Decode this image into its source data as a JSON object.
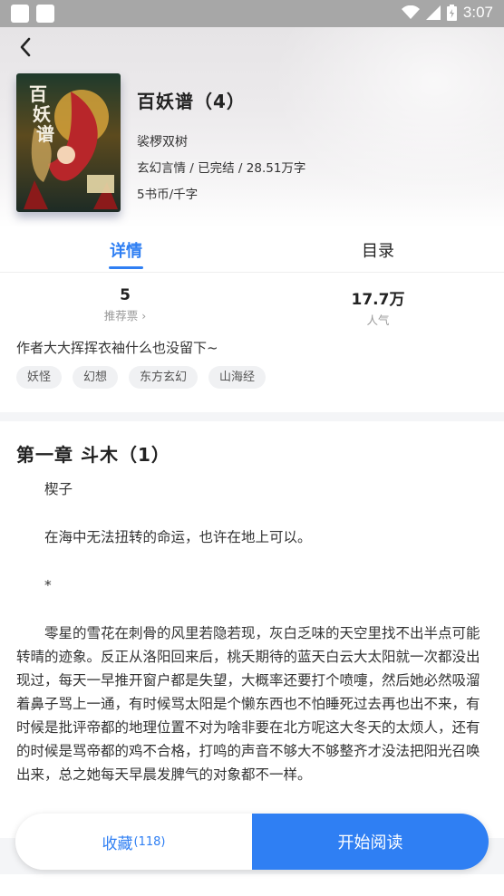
{
  "status_bar": {
    "time": "3:07"
  },
  "book": {
    "title": "百妖谱（4）",
    "author": "裟椤双树",
    "meta": "玄幻言情 / 已完结 / 28.51万字",
    "price": "5书币/千字",
    "cover_text": "百妖谱"
  },
  "tabs": [
    {
      "label": "详情"
    },
    {
      "label": "目录"
    }
  ],
  "stats": {
    "votes": {
      "value": "5",
      "label": "推荐票 ›"
    },
    "popularity": {
      "value": "17.7万",
      "label": "人气"
    }
  },
  "intro": "作者大大挥挥衣袖什么也没留下~",
  "tags": [
    "妖怪",
    "幻想",
    "东方玄幻",
    "山海经"
  ],
  "chapter": {
    "title": "第一章 斗木（1）",
    "paragraphs": [
      "楔子",
      "在海中无法扭转的命运，也许在地上可以。",
      "*",
      "零星的雪花在刺骨的风里若隐若现，灰白乏味的天空里找不出半点可能转晴的迹象。反正从洛阳回来后，桃夭期待的蓝天白云大太阳就一次都没出现过，每天一早推开窗户都是失望，大概率还要打个喷嚏，然后她必然吸溜着鼻子骂上一通，有时候骂太阳是个懒东西也不怕睡死过去再也出不来，有时候是批评帝都的地理位置不对为啥非要在北方呢这大冬天的太烦人，还有的时候是骂帝都的鸡不合格，打鸣的声音不够大不够整齐才没法把阳光召唤出来，总之她每天早晨发脾气的对象都不一样。"
    ]
  },
  "actions": {
    "favorite_label": "收藏",
    "favorite_count": "(118)",
    "read_label": "开始阅读"
  },
  "colors": {
    "accent": "#2f7ff3"
  },
  "icons": [
    "back-arrow-icon",
    "wifi-icon",
    "signal-icon",
    "battery-icon"
  ]
}
